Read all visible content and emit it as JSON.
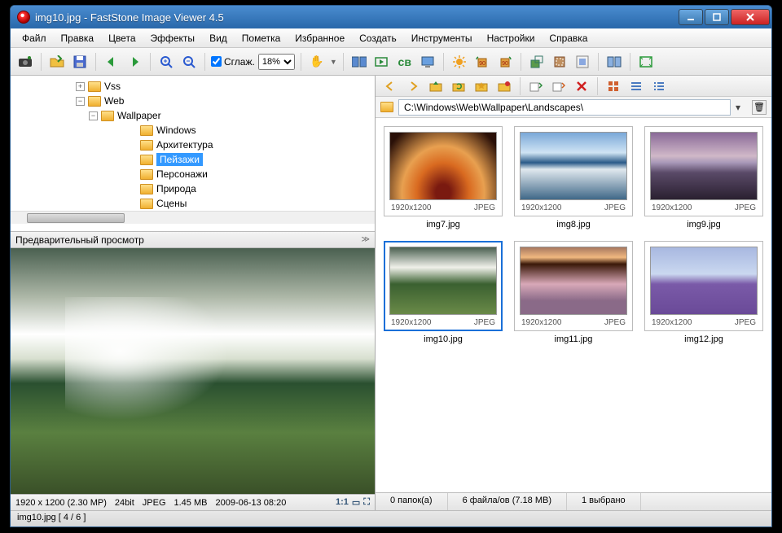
{
  "title": "img10.jpg  -  FastStone Image Viewer 4.5",
  "menu": [
    "Файл",
    "Правка",
    "Цвета",
    "Эффекты",
    "Вид",
    "Пометка",
    "Избранное",
    "Создать",
    "Инструменты",
    "Настройки",
    "Справка"
  ],
  "toolbar": {
    "smooth_label": "Сглаж.",
    "zoom_value": "18%"
  },
  "tree": [
    {
      "indent": 1,
      "exp": "+",
      "label": "Vss"
    },
    {
      "indent": 1,
      "exp": "−",
      "label": "Web"
    },
    {
      "indent": 2,
      "exp": "−",
      "label": "Wallpaper"
    },
    {
      "indent": 4,
      "exp": "",
      "label": "Windows"
    },
    {
      "indent": 4,
      "exp": "",
      "label": "Архитектура"
    },
    {
      "indent": 4,
      "exp": "",
      "label": "Пейзажи",
      "sel": true
    },
    {
      "indent": 4,
      "exp": "",
      "label": "Персонажи"
    },
    {
      "indent": 4,
      "exp": "",
      "label": "Природа"
    },
    {
      "indent": 4,
      "exp": "",
      "label": "Сцены"
    }
  ],
  "preview_header": "Предварительный просмотр",
  "info": {
    "dims": "1920 x 1200 (2.30 MP)",
    "depth": "24bit",
    "fmt": "JPEG",
    "size": "1.45 MB",
    "date": "2009-06-13 08:20"
  },
  "path": "C:\\Windows\\Web\\Wallpaper\\Landscapes\\",
  "thumbs": [
    {
      "name": "img7.jpg",
      "res": "1920x1200",
      "fmt": "JPEG",
      "cls": "tp1"
    },
    {
      "name": "img8.jpg",
      "res": "1920x1200",
      "fmt": "JPEG",
      "cls": "tp2"
    },
    {
      "name": "img9.jpg",
      "res": "1920x1200",
      "fmt": "JPEG",
      "cls": "tp3"
    },
    {
      "name": "img10.jpg",
      "res": "1920x1200",
      "fmt": "JPEG",
      "cls": "tp4",
      "sel": true
    },
    {
      "name": "img11.jpg",
      "res": "1920x1200",
      "fmt": "JPEG",
      "cls": "tp5"
    },
    {
      "name": "img12.jpg",
      "res": "1920x1200",
      "fmt": "JPEG",
      "cls": "tp6"
    }
  ],
  "status": {
    "folders": "0 папок(а)",
    "files": "6 файла/ов (7.18 MB)",
    "selected": "1 выбрано"
  },
  "bottom": "img10.jpg  [ 4 / 6 ]"
}
